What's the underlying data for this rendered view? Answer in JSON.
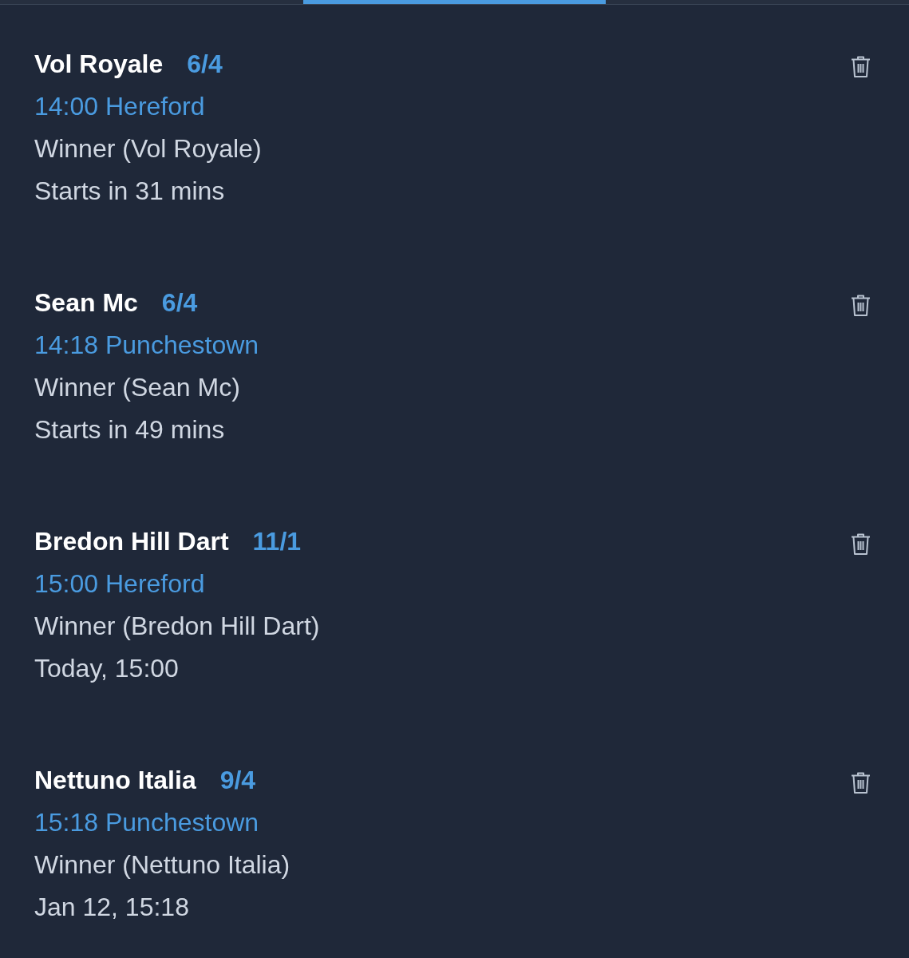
{
  "tabs": [
    {
      "selected": false
    },
    {
      "selected": true
    },
    {
      "selected": false
    }
  ],
  "bets": [
    {
      "selection": "Vol Royale",
      "odds": "6/4",
      "race": "14:00 Hereford",
      "market": "Winner (Vol Royale)",
      "start": "Starts in 31 mins"
    },
    {
      "selection": "Sean Mc",
      "odds": "6/4",
      "race": "14:18 Punchestown",
      "market": "Winner (Sean Mc)",
      "start": "Starts in 49 mins"
    },
    {
      "selection": "Bredon Hill Dart",
      "odds": "11/1",
      "race": "15:00 Hereford",
      "market": "Winner (Bredon Hill Dart)",
      "start": "Today, 15:00"
    },
    {
      "selection": "Nettuno Italia",
      "odds": "9/4",
      "race": "15:18 Punchestown",
      "market": "Winner (Nettuno Italia)",
      "start": "Jan 12, 15:18"
    }
  ]
}
